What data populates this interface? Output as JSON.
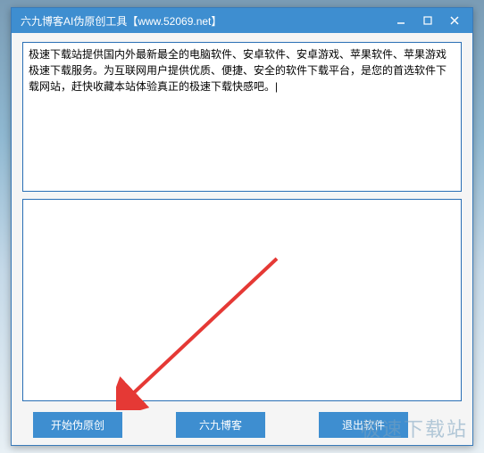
{
  "window": {
    "title": "六九博客AI伪原创工具【www.52069.net】"
  },
  "input": {
    "text": "极速下载站提供国内外最新最全的电脑软件、安卓软件、安卓游戏、苹果软件、苹果游戏极速下载服务。为互联网用户提供优质、便捷、安全的软件下载平台，是您的首选软件下载网站，赶快收藏本站体验真正的极速下载快感吧。|"
  },
  "output": {
    "text": ""
  },
  "buttons": {
    "start": "开始伪原创",
    "blog": "六九博客",
    "exit": "退出软件"
  },
  "watermark": "极速下载站"
}
